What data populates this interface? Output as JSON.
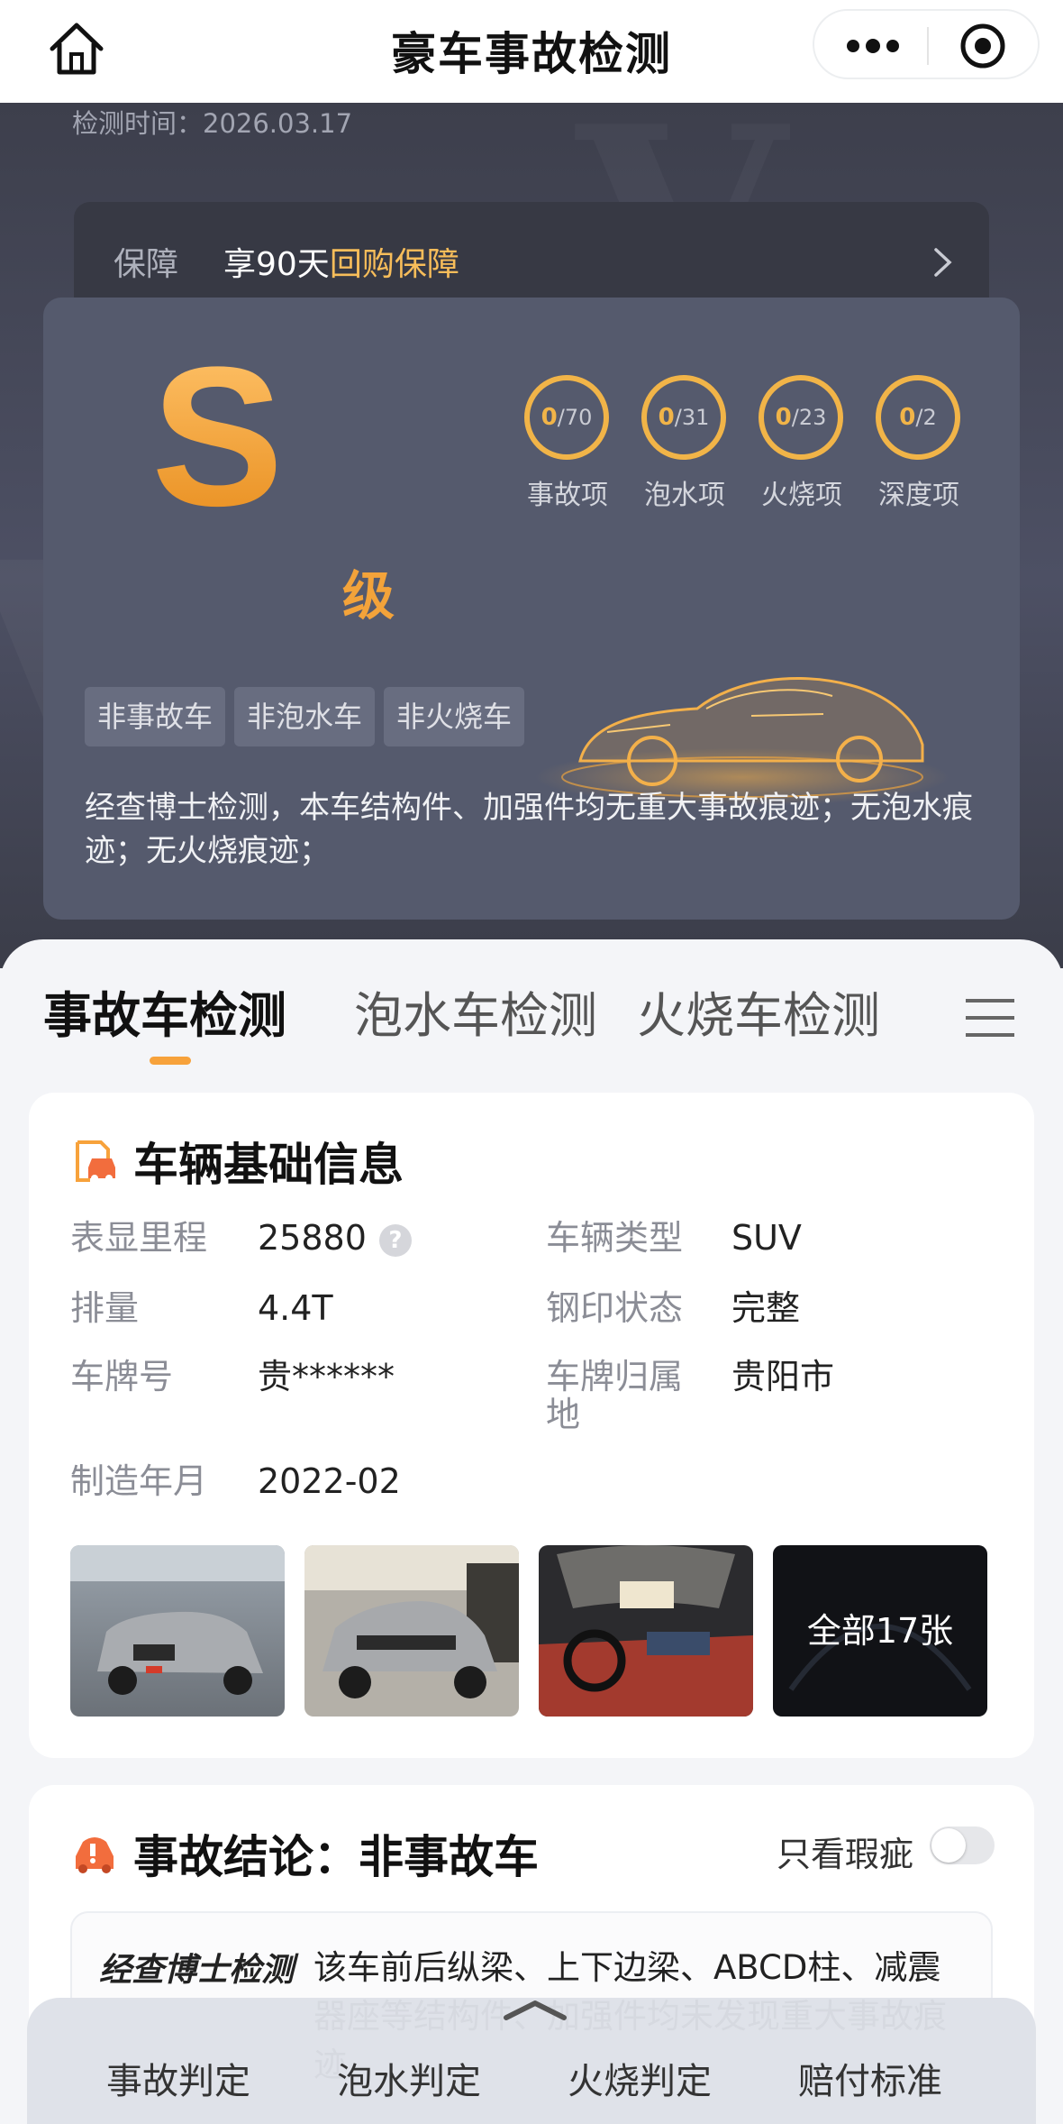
{
  "nav": {
    "title": "豪车事故检测"
  },
  "hero": {
    "inspection_time": "检测时间：2026.03.17",
    "guarantee_label": "保障",
    "guarantee_prefix": "享90天",
    "guarantee_highlight": "回购保障",
    "grade": "S",
    "grade_suffix": "级",
    "stats": [
      {
        "num": "0",
        "den": "/70",
        "label": "事故项"
      },
      {
        "num": "0",
        "den": "/31",
        "label": "泡水项"
      },
      {
        "num": "0",
        "den": "/23",
        "label": "火烧项"
      },
      {
        "num": "0",
        "den": "/2",
        "label": "深度项"
      }
    ],
    "tags": [
      "非事故车",
      "非泡水车",
      "非火烧车"
    ],
    "summary": "经查博士检测，本车结构件、加强件均无重大事故痕迹；无泡水痕迹；无火烧痕迹；"
  },
  "tabs": [
    "事故车检测",
    "泡水车检测",
    "火烧车检测"
  ],
  "vehicle_info": {
    "title": "车辆基础信息",
    "fields": {
      "mileage_label": "表显里程",
      "mileage_value": "25880",
      "type_label": "车辆类型",
      "type_value": "SUV",
      "displacement_label": "排量",
      "displacement_value": "4.4T",
      "stamp_label": "钢印状态",
      "stamp_value": "完整",
      "plate_label": "车牌号",
      "plate_value": "贵******",
      "region_label_1": "车牌归属",
      "region_label_2": "地",
      "region_value": "贵阳市",
      "date_label": "制造年月",
      "date_value": "2022-02"
    },
    "photos_all": "全部17张",
    "qmark": "?"
  },
  "accident": {
    "title": "事故结论：非事故车",
    "toggle_label": "只看瑕疵",
    "brand": "经查博士检测",
    "body": "该车前后纵梁、上下边梁、ABCD柱、减震器座等结构件、加强件均未发现重大事故痕迹"
  },
  "bottom_bar": [
    "事故判定",
    "泡水判定",
    "火烧判定",
    "赔付标准"
  ],
  "colors": {
    "accent": "#f7a23b",
    "gold": "#f1b448",
    "hero_bg": "#4d5064",
    "highlight": "#f7bd5a"
  }
}
